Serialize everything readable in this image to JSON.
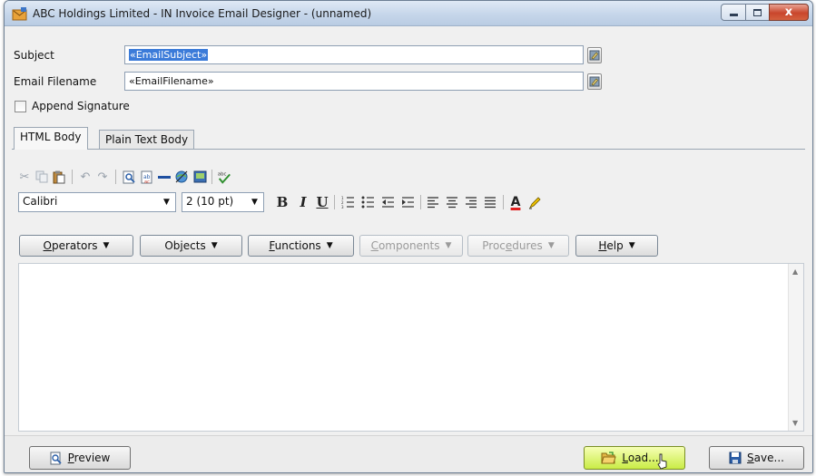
{
  "window": {
    "title": "ABC Holdings Limited - IN Invoice Email Designer - (unnamed)",
    "close_glyph": "x"
  },
  "fields": {
    "subject_label": "Subject",
    "subject_value": "«EmailSubject»",
    "filename_label": "Email Filename",
    "filename_value": "«EmailFilename»",
    "append_signature_label": "Append Signature",
    "append_signature_checked": false
  },
  "tabs": [
    {
      "label": "HTML Body",
      "active": true
    },
    {
      "label": "Plain Text Body",
      "active": false
    }
  ],
  "toolbar": {
    "font_family": "Calibri",
    "font_size": "2 (10 pt)",
    "bold": "B",
    "italic": "I",
    "underline": "U",
    "font_color": "A"
  },
  "menus": [
    {
      "prefix": "",
      "key": "O",
      "rest": "perators",
      "enabled": true
    },
    {
      "prefix": "Ob",
      "key": "j",
      "rest": "ects",
      "enabled": true
    },
    {
      "prefix": "",
      "key": "F",
      "rest": "unctions",
      "enabled": true
    },
    {
      "prefix": "",
      "key": "C",
      "rest": "omponents",
      "enabled": false
    },
    {
      "prefix": "Proc",
      "key": "e",
      "rest": "dures",
      "enabled": false
    },
    {
      "prefix": "",
      "key": "H",
      "rest": "elp",
      "enabled": true
    }
  ],
  "footer": {
    "preview": {
      "key": "P",
      "rest": "review"
    },
    "load": {
      "key": "L",
      "rest": "oad..."
    },
    "save": {
      "key": "S",
      "rest": "ave..."
    }
  },
  "colors": {
    "selection": "#3b7bd9",
    "load_button": "#c9ec46",
    "title_bar": "#c6d6ea"
  }
}
